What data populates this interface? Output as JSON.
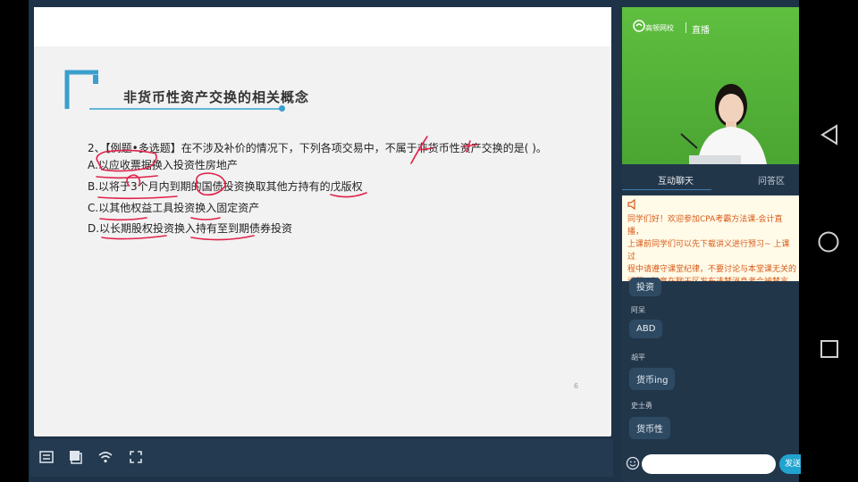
{
  "slide": {
    "title": "非货币性资产交换的相关概念",
    "question": "2、【例题•多选题】在不涉及补价的情况下，下列各项交易中，不属于非货币性资产交换的是(    )。",
    "options": [
      "A.以应收票据换入投资性房地产",
      "B.以将于3个月内到期的国债投资换取其他方持有的戊版权",
      "C.以其他权益工具投资换入固定资产",
      "D.以长期股权投资换入持有至到期债券投资"
    ],
    "page_number": "6",
    "annotation_color": "#e0224a",
    "accent_color": "#3a9fcc"
  },
  "live": {
    "logo": "高顿网校",
    "live_label": "直播"
  },
  "panel": {
    "tabs": [
      "互动聊天",
      "问答区"
    ],
    "notice": "同学们好！欢迎参加CPA考霸方法课-会计直播，\n上课前同学们可以先下载讲义进行预习~ 上课过\n程中请遵守课堂纪律，不要讨论与本堂课无关的\n话题。随意在聊天区发布违禁消息者会被禁言\n。",
    "messages": [
      {
        "name": "",
        "text": "投资"
      },
      {
        "name": "阿呆",
        "text": "ABD"
      },
      {
        "name": "胡平",
        "text": "货币ing"
      },
      {
        "name": "史士勇",
        "text": "货币性"
      }
    ],
    "send_label": "发送"
  }
}
